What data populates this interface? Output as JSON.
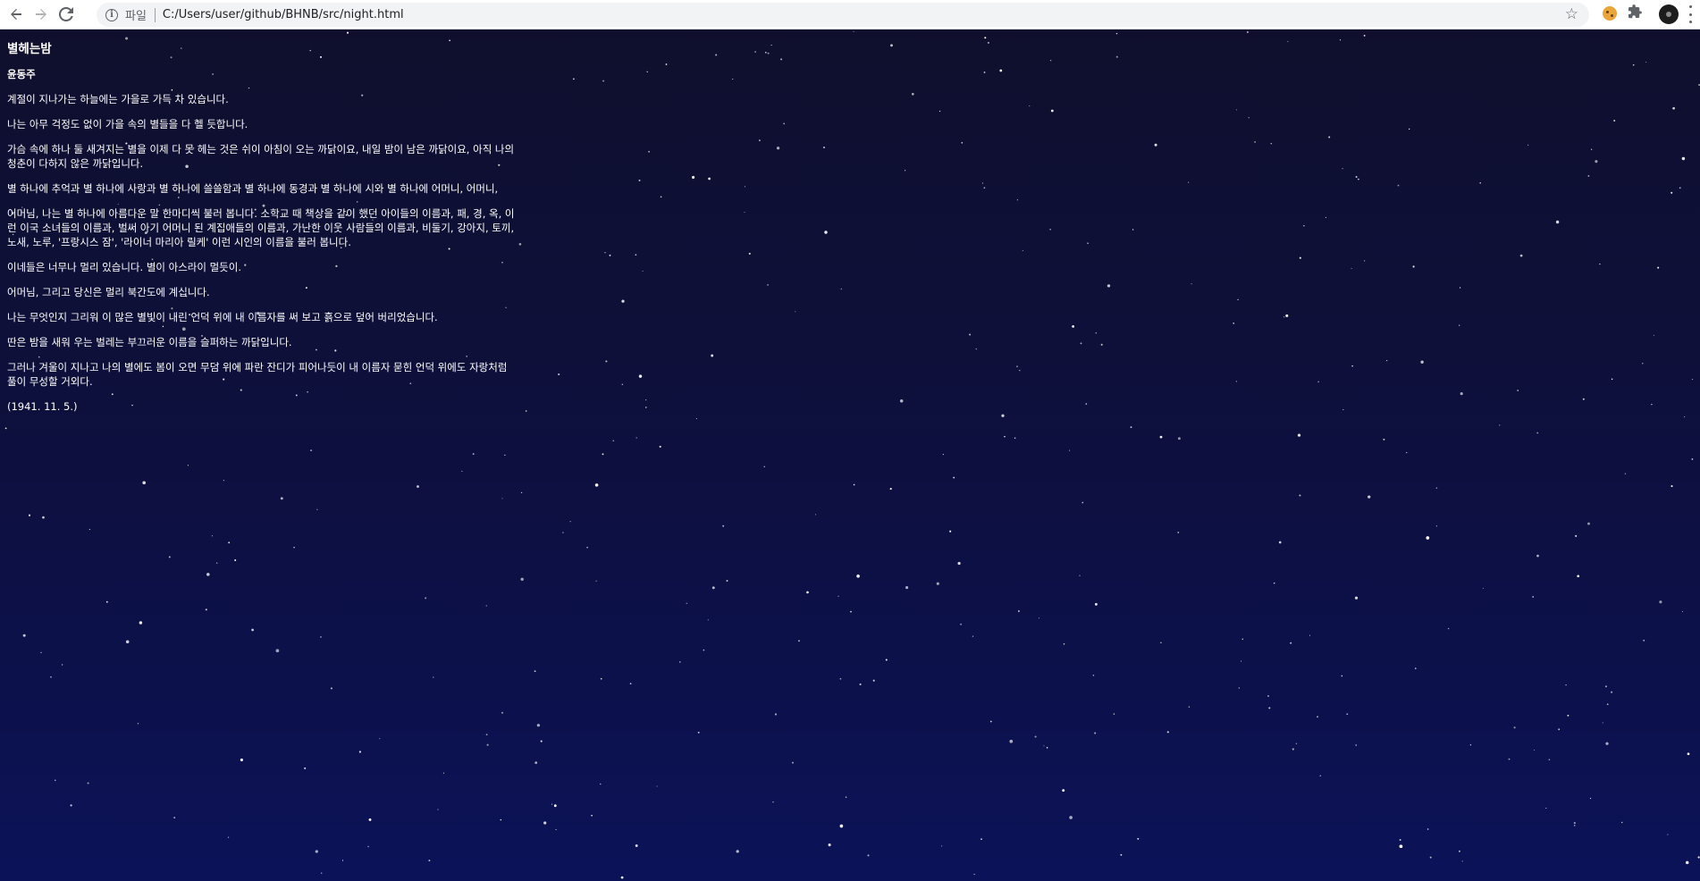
{
  "browser": {
    "back_icon": "arrow-left-icon",
    "forward_icon": "arrow-right-icon",
    "reload_icon": "reload-icon",
    "scheme_label": "파일",
    "url": "C:/Users/user/github/BHNB/src/night.html"
  },
  "poem": {
    "title": "별헤는밤",
    "author": "윤동주",
    "stanzas": [
      "계절이 지나가는 하늘에는 가을로 가득 차 있습니다.",
      "나는 아무 걱정도 없이 가을 속의 별들을 다 헬 듯합니다.",
      "가슴 속에 하나 둘 새겨지는 별을 이제 다 못 헤는 것은 쉬이 아침이 오는 까닭이요, 내일 밤이 남은 까닭이요, 아직 나의 청춘이 다하지 않은 까닭입니다.",
      "별 하나에 추억과 별 하나에 사랑과 별 하나에 쓸쓸함과 별 하나에 동경과 별 하나에 시와 별 하나에 어머니, 어머니,",
      "어머님, 나는 별 하나에 아름다운 말 한마디씩 불러 봅니다. 소학교 때 책상을 같이 했던 아이들의 이름과, 패, 경, 옥, 이런 이국 소녀들의 이름과, 벌써 아기 어머니 된 계집애들의 이름과, 가난한 이웃 사람들의 이름과, 비둘기, 강아지, 토끼, 노새, 노루, '프랑시스 잠', '라이너 마리아 릴케' 이런 시인의 이름을 불러 봅니다.",
      "이네들은 너무나 멀리 있습니다. 별이 아스라이 멀듯이.",
      "어머님, 그리고 당신은 멀리 북간도에 계십니다.",
      "나는 무엇인지 그리워 이 많은 별빛이 내린 언덕 위에 내 이름자를 써 보고 흙으로 덮어 버리었습니다.",
      "딴은 밤을 새워 우는 벌레는 부끄러운 이름을 슬퍼하는 까닭입니다.",
      "그러나 겨울이 지나고 나의 별에도 봄이 오면 무덤 위에 파란 잔디가 피어나듯이 내 이름자 묻힌 언덕 위에도 자랑처럼 풀이 무성할 거외다."
    ],
    "date": "(1941. 11. 5.)"
  },
  "colors": {
    "sky_top": "#0f0f2d",
    "sky_bottom": "#0b1258",
    "text": "#ffffff",
    "star": "#ffffff"
  }
}
